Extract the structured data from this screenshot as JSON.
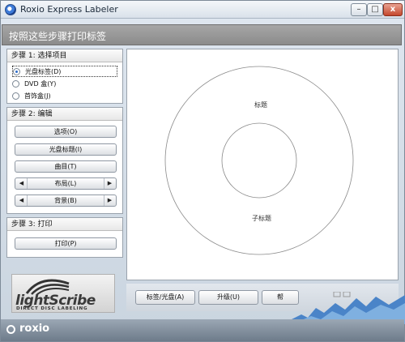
{
  "window": {
    "title": "Roxio Express Labeler",
    "min": "–",
    "max": "□",
    "close": "x"
  },
  "instruction": "按照这些步骤打印标签",
  "step1": {
    "title": "步骤 1: 选择项目",
    "options": [
      {
        "label": "光盘标签(D)",
        "selected": true
      },
      {
        "label": "DVD 盒(Y)",
        "selected": false
      },
      {
        "label": "首饰盒(J)",
        "selected": false
      }
    ]
  },
  "step2": {
    "title": "步骤 2: 编辑",
    "options_btn": "选项(O)",
    "disc_title_btn": "光盘标题(I)",
    "tracks_btn": "曲目(T)",
    "layout_label": "布局(L)",
    "background_label": "背景(B)"
  },
  "step3": {
    "title": "步骤 3: 打印",
    "print_btn": "打印(P)"
  },
  "logo": {
    "word": "lightScribe",
    "tag": "DIRECT DISC LABELING"
  },
  "canvas": {
    "title_text": "标题",
    "subtitle_text": "子标题"
  },
  "bottom": {
    "label_disc_btn": "标签/光盘(A)",
    "upgrade_btn": "升级(U)",
    "help_btn": "帮"
  },
  "footer": {
    "brand": "roxio"
  }
}
